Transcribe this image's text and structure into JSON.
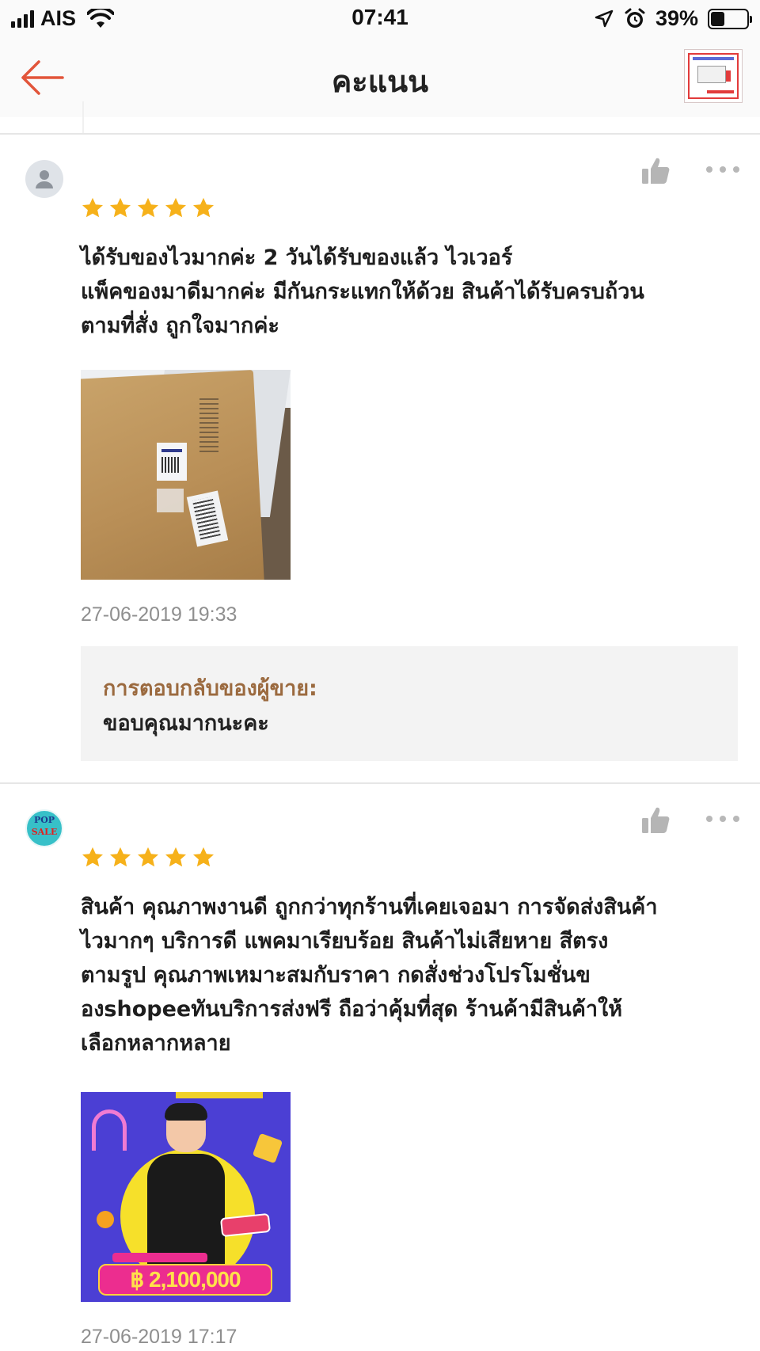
{
  "status_bar": {
    "carrier": "AIS",
    "time": "07:41",
    "battery_percent": "39%",
    "battery_level": 0.39
  },
  "nav": {
    "title": "คะแนน",
    "back_icon": "arrow-left-icon",
    "accent_color": "#e2553a"
  },
  "reviews": [
    {
      "avatar": "default-user-avatar",
      "rating": 5,
      "text": "ได้รับของไวมากค่ะ 2 วันได้รับของแล้ว ไวเวอร์\nแพ็คของมาดีมากค่ะ มีกันกระแทกให้ด้วย สินค้าได้รับครบถ้วน\nตามที่สั่ง ถูกใจมากค่ะ",
      "date": "27-06-2019 19:33",
      "seller_reply": {
        "label": "การตอบกลับของผู้ขาย:",
        "text": "ขอบคุณมากนะคะ"
      }
    },
    {
      "avatar": "pop-sale-avatar",
      "avatar_text_top": "POP",
      "avatar_text_bottom": "SALE",
      "rating": 5,
      "text": "สินค้า คุณภาพงานดี  ถูกกว่าทุกร้านที่เคยเจอมา การจัดส่งสินค้า\nไวมากๆ  บริการดี  แพคมาเรียบร้อย  สินค้าไม่เสียหาย สีตรง\nตามรูป คุณภาพเหมาะสมกับราคา กดสั่งช่วงโปรโมชั่นข\nองshopeeทันบริการส่งฟรี ถือว่าคุ้มที่สุด ร้านค้ามีสินค้าให้\nเลือกหลากหลาย",
      "image_price_text": "฿ 2,100,000",
      "date": "27-06-2019 17:17"
    }
  ],
  "colors": {
    "star": "#f6b11a",
    "reply_label": "#9b6a3f",
    "date": "#8f8f8f"
  }
}
